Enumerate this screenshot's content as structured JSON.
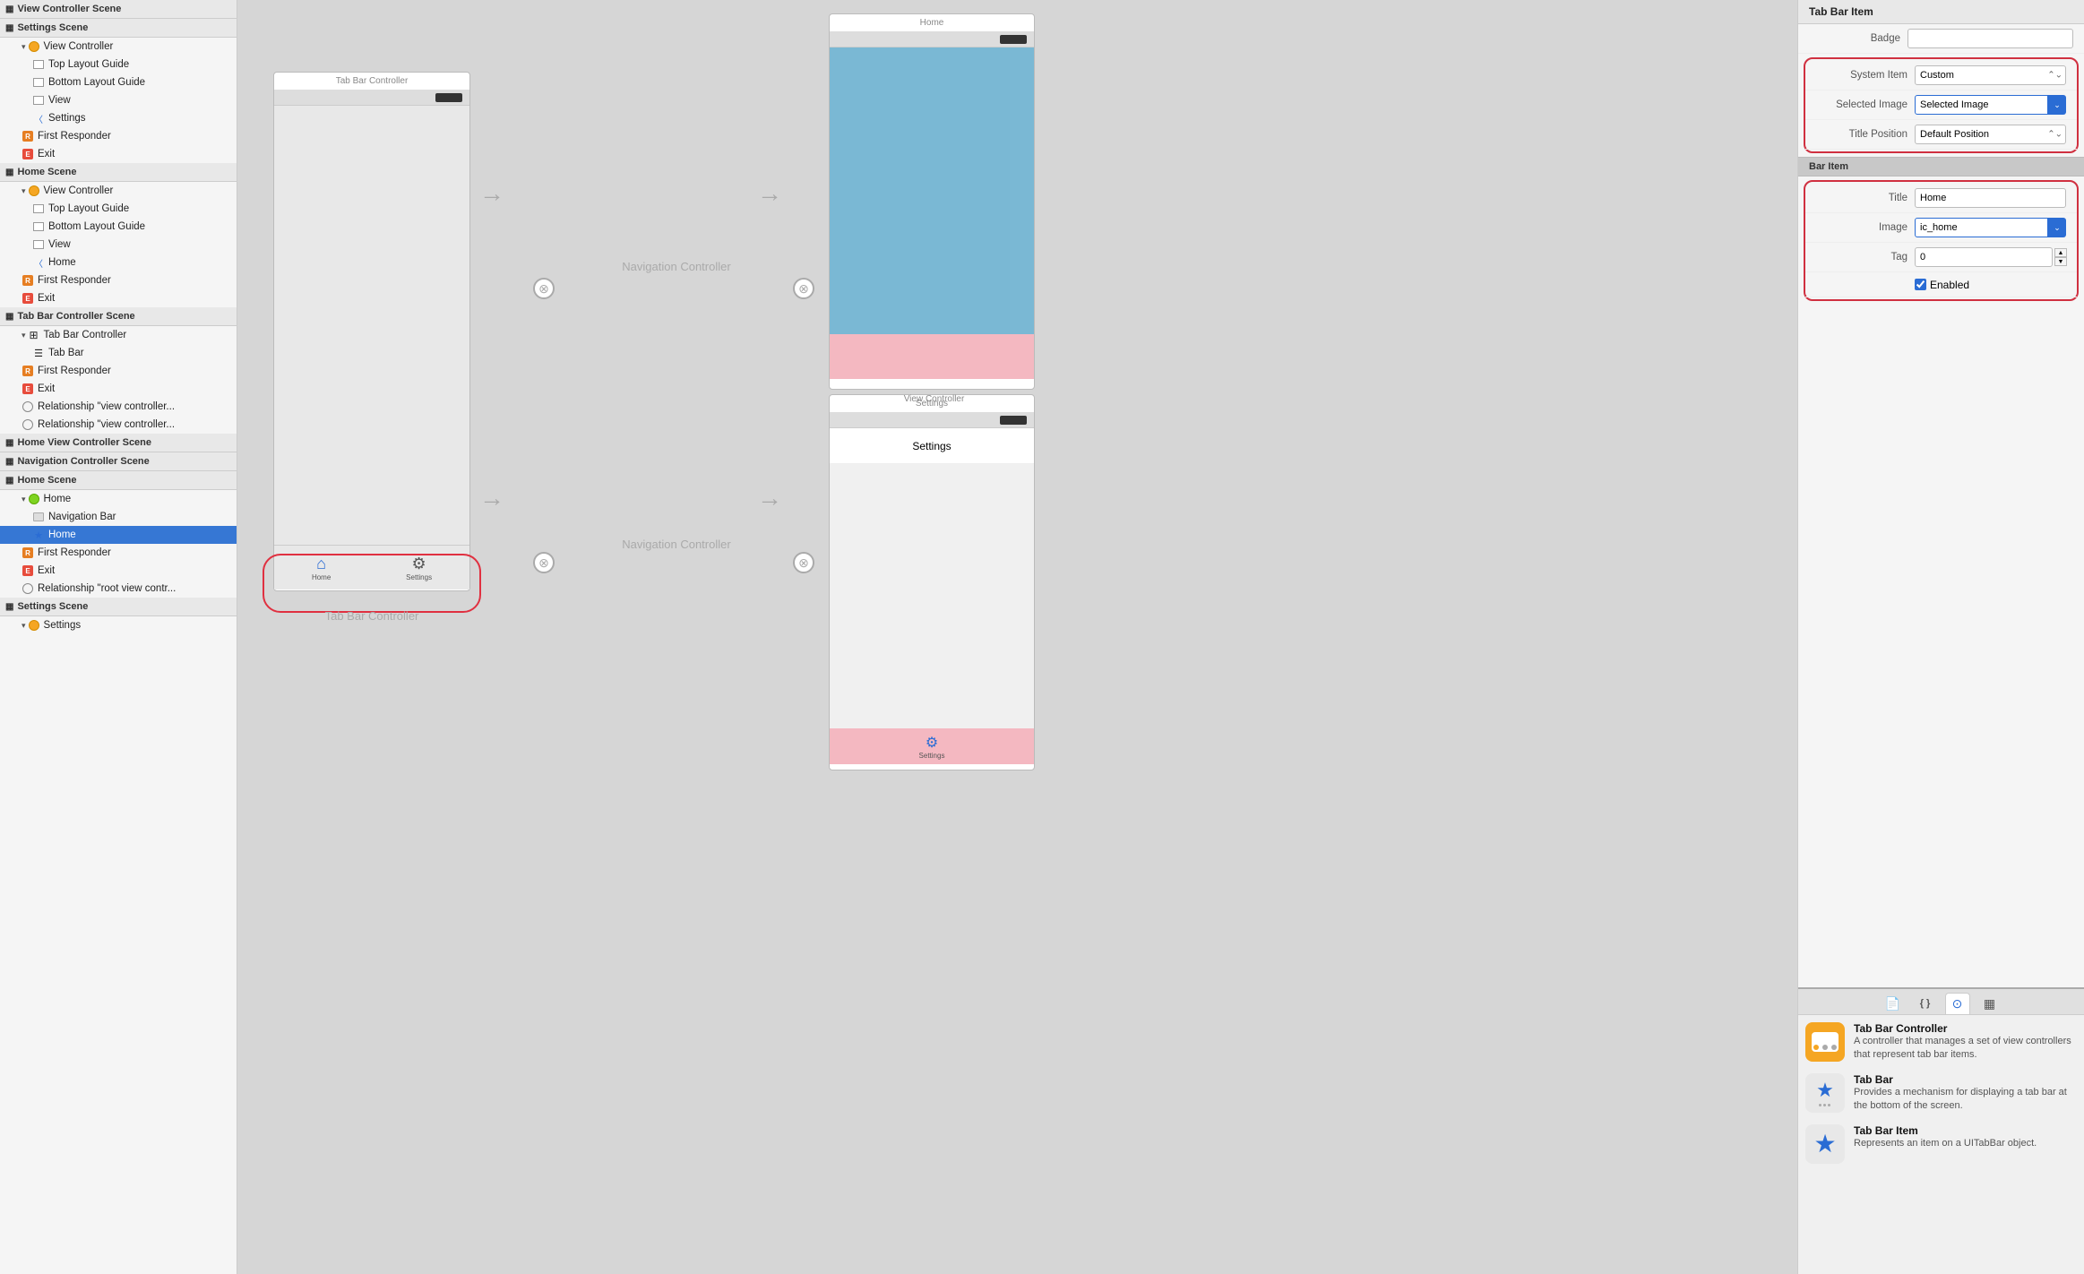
{
  "sidebar": {
    "sections": [
      {
        "id": "view-controller-scene",
        "label": "View Controller Scene",
        "items": []
      },
      {
        "id": "settings-scene-top",
        "label": "Settings Scene",
        "items": [
          {
            "id": "vc-top",
            "label": "View Controller",
            "indent": 1,
            "type": "yellow-dot",
            "chevron": true
          },
          {
            "id": "top-layout",
            "label": "Top Layout Guide",
            "indent": 2,
            "type": "rect"
          },
          {
            "id": "bottom-layout",
            "label": "Bottom Layout Guide",
            "indent": 2,
            "type": "rect"
          },
          {
            "id": "view-top",
            "label": "View",
            "indent": 2,
            "type": "rect"
          },
          {
            "id": "settings-link",
            "label": "Settings",
            "indent": 2,
            "type": "chevron-blue"
          },
          {
            "id": "first-resp-top",
            "label": "First Responder",
            "indent": 1,
            "type": "responder"
          },
          {
            "id": "exit-top",
            "label": "Exit",
            "indent": 1,
            "type": "exit"
          }
        ]
      },
      {
        "id": "home-scene-top",
        "label": "Home Scene",
        "items": [
          {
            "id": "vc-home",
            "label": "View Controller",
            "indent": 1,
            "type": "yellow-dot",
            "chevron": true
          },
          {
            "id": "top-layout-home",
            "label": "Top Layout Guide",
            "indent": 2,
            "type": "rect"
          },
          {
            "id": "bottom-layout-home",
            "label": "Bottom Layout Guide",
            "indent": 2,
            "type": "rect"
          },
          {
            "id": "view-home",
            "label": "View",
            "indent": 2,
            "type": "rect"
          },
          {
            "id": "home-link",
            "label": "Home",
            "indent": 2,
            "type": "chevron-blue"
          },
          {
            "id": "first-resp-home",
            "label": "First Responder",
            "indent": 1,
            "type": "responder"
          },
          {
            "id": "exit-home",
            "label": "Exit",
            "indent": 1,
            "type": "exit"
          }
        ]
      },
      {
        "id": "tab-bar-controller-scene",
        "label": "Tab Bar Controller Scene",
        "items": [
          {
            "id": "tbc",
            "label": "Tab Bar Controller",
            "indent": 1,
            "type": "tbc-icon",
            "chevron": true
          },
          {
            "id": "tab-bar",
            "label": "Tab Bar",
            "indent": 2,
            "type": "tab-bar-icon"
          },
          {
            "id": "first-resp-tbc",
            "label": "First Responder",
            "indent": 1,
            "type": "responder"
          },
          {
            "id": "exit-tbc",
            "label": "Exit",
            "indent": 1,
            "type": "exit"
          },
          {
            "id": "rel1",
            "label": "Relationship \"view controller...",
            "indent": 1,
            "type": "relationship"
          },
          {
            "id": "rel2",
            "label": "Relationship \"view controller...",
            "indent": 1,
            "type": "relationship"
          }
        ]
      },
      {
        "id": "home-view-controller-scene",
        "label": "Home View Controller Scene",
        "items": []
      },
      {
        "id": "navigation-controller-scene",
        "label": "Navigation Controller Scene",
        "items": []
      },
      {
        "id": "home-scene-bottom",
        "label": "Home Scene",
        "items": [
          {
            "id": "home-nav",
            "label": "Home",
            "indent": 1,
            "type": "green-dot",
            "chevron": true
          },
          {
            "id": "nav-bar",
            "label": "Navigation Bar",
            "indent": 2,
            "type": "nav-bar"
          },
          {
            "id": "home-star",
            "label": "Home",
            "indent": 2,
            "type": "star",
            "selected": true
          },
          {
            "id": "first-resp-hb",
            "label": "First Responder",
            "indent": 1,
            "type": "responder"
          },
          {
            "id": "exit-hb",
            "label": "Exit",
            "indent": 1,
            "type": "exit"
          },
          {
            "id": "rel-root",
            "label": "Relationship \"root view contr...",
            "indent": 1,
            "type": "relationship"
          }
        ]
      },
      {
        "id": "settings-scene-bottom",
        "label": "Settings Scene",
        "items": [
          {
            "id": "settings-dot",
            "label": "Settings",
            "indent": 1,
            "type": "yellow-dot"
          }
        ]
      }
    ]
  },
  "inspector": {
    "title": "Tab Bar Item",
    "badge_label": "Badge",
    "system_item_label": "System Item",
    "system_item_value": "Custom",
    "selected_image_label": "Selected Image",
    "selected_image_value": "Selected Image",
    "title_position_label": "Title Position",
    "title_position_value": "Default Position",
    "bar_item_section": "Bar Item",
    "bar_title_label": "Title",
    "bar_title_value": "Home",
    "bar_image_label": "Image",
    "bar_image_value": "ic_home",
    "bar_tag_label": "Tag",
    "bar_tag_value": "0",
    "bar_enabled_label": "Enabled"
  },
  "library": {
    "tabs": [
      {
        "id": "file",
        "icon": "📄",
        "active": false
      },
      {
        "id": "object",
        "icon": "{ }",
        "active": false
      },
      {
        "id": "media",
        "icon": "⊙",
        "active": true
      },
      {
        "id": "snippet",
        "icon": "▦",
        "active": false
      }
    ],
    "items": [
      {
        "id": "tab-bar-controller",
        "title": "Tab Bar Controller",
        "description": "A controller that manages a set of view controllers that represent tab bar items."
      },
      {
        "id": "tab-bar",
        "title": "Tab Bar",
        "description": "Provides a mechanism for displaying a tab bar at the bottom of the screen."
      },
      {
        "id": "tab-bar-item",
        "title": "Tab Bar Item",
        "description": "Represents an item on a UITabBar object."
      }
    ]
  },
  "canvas": {
    "tab_bar_controller_label": "Tab Bar Controller",
    "navigation_controller_label": "Navigation Controller",
    "home_nav_title": "Home",
    "settings_nav_title": "Settings",
    "view_controller_label": "View Controller",
    "tab_bar_scene_title": "Tab Bar Controller",
    "home_scene_top_title": "Home",
    "settings_scene_title": "Settings",
    "home_tab_label": "Home",
    "settings_tab_label": "Settings"
  }
}
